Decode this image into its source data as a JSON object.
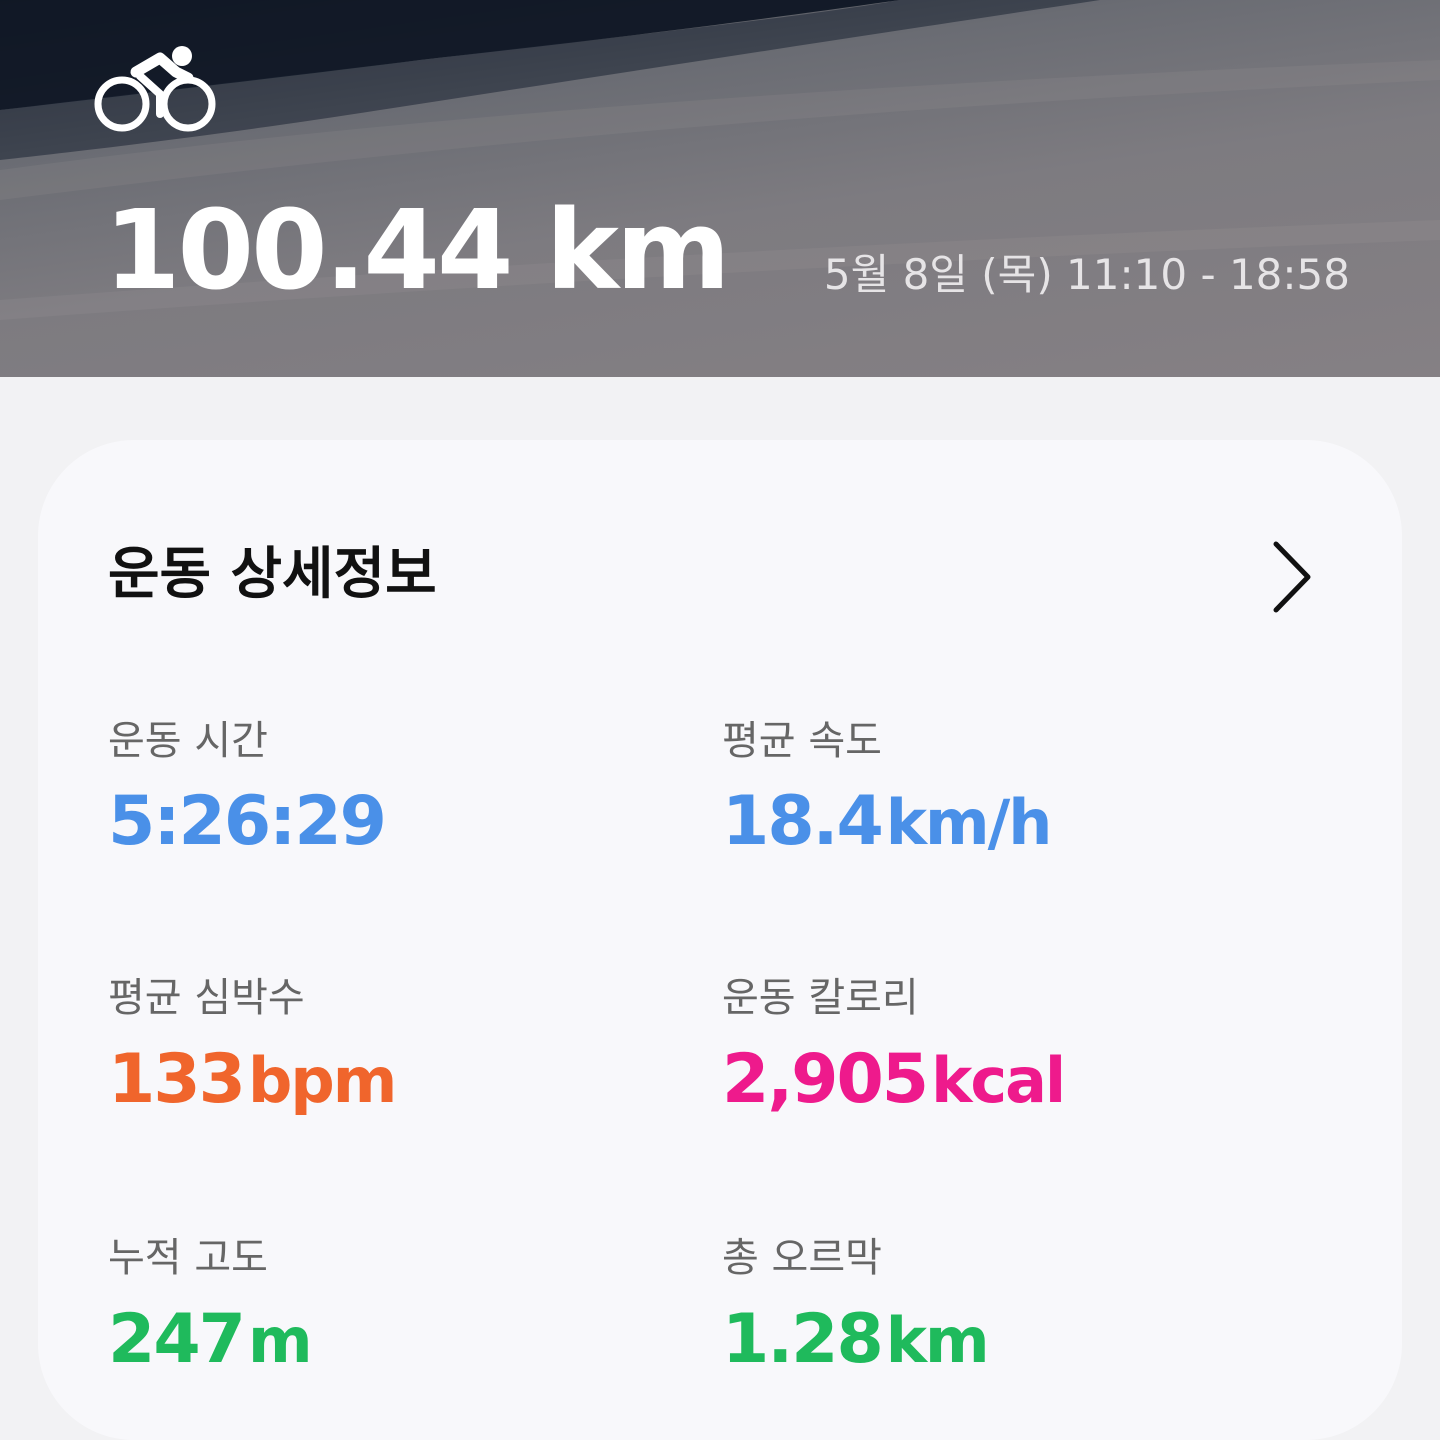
{
  "header": {
    "activity_icon": "cycling-icon",
    "distance": "100.44 km",
    "date_range": "5월 8일 (목) 11:10 - 18:58"
  },
  "details": {
    "title": "운동 상세정보",
    "chevron_icon": "chevron-right-icon",
    "stats": [
      {
        "label": "운동 시간",
        "value": "5:26:29",
        "unit": "",
        "color": "#4a90e8"
      },
      {
        "label": "평균 속도",
        "value": "18.4",
        "unit": "km/h",
        "color": "#4a90e8"
      },
      {
        "label": "평균 심박수",
        "value": "133",
        "unit": "bpm",
        "color": "#f0652c"
      },
      {
        "label": "운동 칼로리",
        "value": "2,905",
        "unit": "kcal",
        "color": "#ee1a8c"
      },
      {
        "label": "누적 고도",
        "value": "247",
        "unit": "m",
        "color": "#1fba5c"
      },
      {
        "label": "총 오르막",
        "value": "1.28",
        "unit": "km",
        "color": "#1fba5c"
      }
    ]
  },
  "colors": {
    "hero_bg": "#6a6c73",
    "card_bg": "#f8f8fb",
    "page_bg": "#f2f2f4"
  }
}
